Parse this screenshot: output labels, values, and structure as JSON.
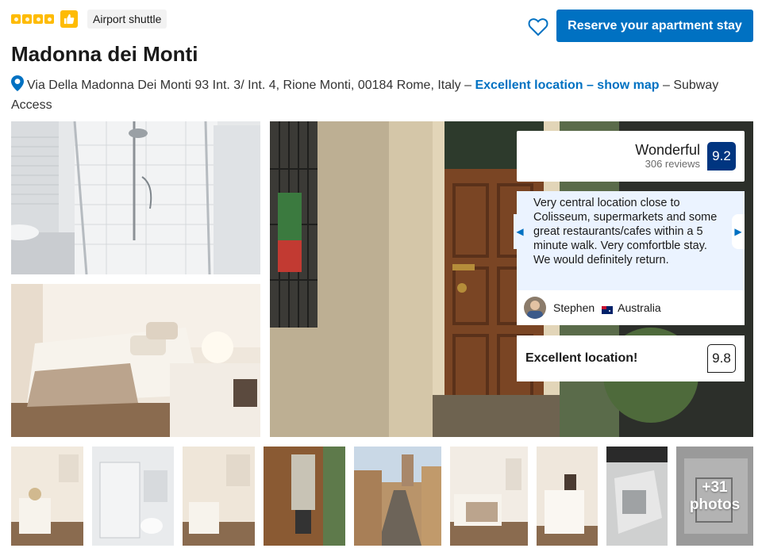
{
  "header": {
    "stars": 4,
    "facility_tag": "Airport shuttle",
    "reserve_label": "Reserve your apartment stay"
  },
  "property": {
    "name": "Madonna dei Monti",
    "address": "Via Della Madonna Dei Monti 93 Int. 3/ Int. 4, Rione Monti, 00184 Rome, Italy",
    "separator1": " – ",
    "map_link": "Excellent location – show map",
    "separator2": " – ",
    "transport": "Subway Access"
  },
  "review": {
    "rating_word": "Wonderful",
    "review_count": "306 reviews",
    "score": "9.2",
    "quote": "Very central location close to Colisseum, supermarkets and some great restaurants/cafes within a 5 minute walk. Very comfortble stay. We would definitely return.",
    "reviewer_name": "Stephen",
    "reviewer_country": "Australia",
    "location_label": "Excellent location!",
    "location_score": "9.8"
  },
  "gallery": {
    "more_count": "+31",
    "more_label": "photos"
  },
  "colors": {
    "accent": "#0071c2",
    "score_bg": "#003580",
    "star": "#febb02"
  }
}
